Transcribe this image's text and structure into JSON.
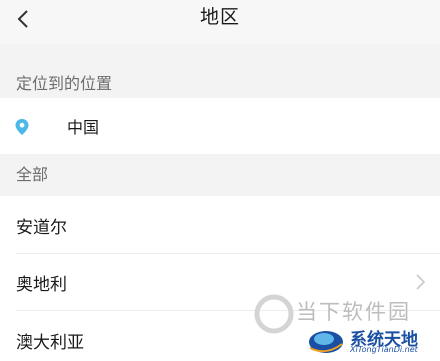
{
  "header": {
    "back_icon": "chevron-left-icon",
    "title": "地区"
  },
  "located": {
    "section_label": "定位到的位置",
    "icon": "location-pin-icon",
    "value": "中国",
    "accent_color": "#4ab8e8"
  },
  "all": {
    "section_label": "全部",
    "items": [
      {
        "label": "安道尔"
      },
      {
        "label": "奥地利",
        "chevron": "chevron-right-icon"
      },
      {
        "label": "澳大利亚"
      }
    ]
  },
  "watermark": {
    "text": "当下软件园",
    "brand": "系统天地",
    "brand_url": "XiTongTianDi.net"
  }
}
